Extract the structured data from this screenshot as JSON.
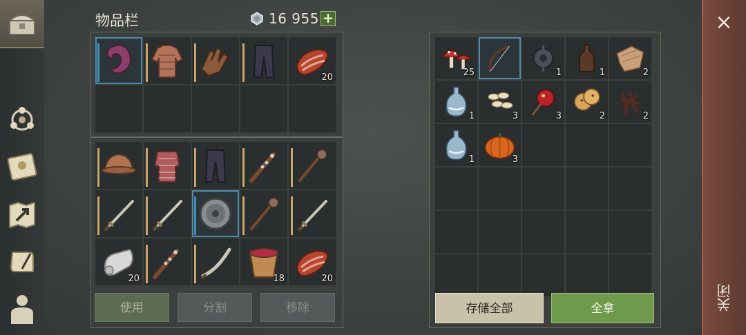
{
  "title": "物品栏",
  "currency": {
    "icon": "gem-icon",
    "amount": "16 955",
    "add_label": "+"
  },
  "equipment": [
    {
      "icon": "hood-icon",
      "count": "",
      "selected": true
    },
    {
      "icon": "chainmail-shirt-icon",
      "count": ""
    },
    {
      "icon": "leather-gloves-icon",
      "count": ""
    },
    {
      "icon": "pants-icon",
      "count": ""
    },
    {
      "icon": "raw-meat-icon",
      "count": "20"
    },
    {
      "icon": "",
      "count": ""
    },
    {
      "icon": "",
      "count": ""
    },
    {
      "icon": "",
      "count": ""
    },
    {
      "icon": "",
      "count": ""
    },
    {
      "icon": "",
      "count": ""
    }
  ],
  "inventory": [
    {
      "icon": "helmet-icon",
      "count": ""
    },
    {
      "icon": "chainmail-armor-icon",
      "count": ""
    },
    {
      "icon": "pants-icon",
      "count": ""
    },
    {
      "icon": "spiked-club-icon",
      "count": ""
    },
    {
      "icon": "mace-icon",
      "count": ""
    },
    {
      "icon": "sword-icon",
      "count": ""
    },
    {
      "icon": "sword-icon",
      "count": ""
    },
    {
      "icon": "round-shield-icon",
      "count": "",
      "selected": true
    },
    {
      "icon": "mace-icon",
      "count": ""
    },
    {
      "icon": "sword-icon",
      "count": ""
    },
    {
      "icon": "cloth-roll-icon",
      "count": "20"
    },
    {
      "icon": "spiked-club-icon",
      "count": ""
    },
    {
      "icon": "sickle-sword-icon",
      "count": ""
    },
    {
      "icon": "berry-bucket-icon",
      "count": "18"
    },
    {
      "icon": "raw-meat-icon",
      "count": "20"
    }
  ],
  "actions": {
    "use": "使用",
    "split": "分割",
    "remove": "移除"
  },
  "container": [
    {
      "icon": "mushrooms-icon",
      "count": "25"
    },
    {
      "icon": "bow-icon",
      "count": "",
      "selected": true
    },
    {
      "icon": "gear-scrap-icon",
      "count": "1"
    },
    {
      "icon": "bottle-icon",
      "count": "1"
    },
    {
      "icon": "cloth-icon",
      "count": "2"
    },
    {
      "icon": "water-flask-icon",
      "count": "1"
    },
    {
      "icon": "seeds-icon",
      "count": "3"
    },
    {
      "icon": "candy-apple-icon",
      "count": "3"
    },
    {
      "icon": "cookies-icon",
      "count": "2"
    },
    {
      "icon": "roots-icon",
      "count": "2"
    },
    {
      "icon": "water-flask-icon",
      "count": "1"
    },
    {
      "icon": "pumpkin-icon",
      "count": "3"
    },
    {
      "icon": "",
      "count": ""
    },
    {
      "icon": "",
      "count": ""
    },
    {
      "icon": "",
      "count": ""
    },
    {
      "icon": "",
      "count": ""
    },
    {
      "icon": "",
      "count": ""
    },
    {
      "icon": "",
      "count": ""
    },
    {
      "icon": "",
      "count": ""
    },
    {
      "icon": "",
      "count": ""
    },
    {
      "icon": "",
      "count": ""
    },
    {
      "icon": "",
      "count": ""
    },
    {
      "icon": "",
      "count": ""
    },
    {
      "icon": "",
      "count": ""
    },
    {
      "icon": "",
      "count": ""
    },
    {
      "icon": "",
      "count": ""
    },
    {
      "icon": "",
      "count": ""
    },
    {
      "icon": "",
      "count": ""
    },
    {
      "icon": "",
      "count": ""
    },
    {
      "icon": "",
      "count": ""
    }
  ],
  "container_actions": {
    "store_all": "存储全部",
    "take_all": "全拿"
  },
  "close": {
    "icon": "close-icon",
    "symbol": "×",
    "label": "关闭"
  },
  "sidebar": [
    {
      "icon": "chest-icon",
      "active": true
    },
    {
      "icon": "skills-icon"
    },
    {
      "icon": "sun-book-icon"
    },
    {
      "icon": "map-arrow-icon"
    },
    {
      "icon": "scroll-quill-icon"
    },
    {
      "icon": "character-icon"
    }
  ]
}
